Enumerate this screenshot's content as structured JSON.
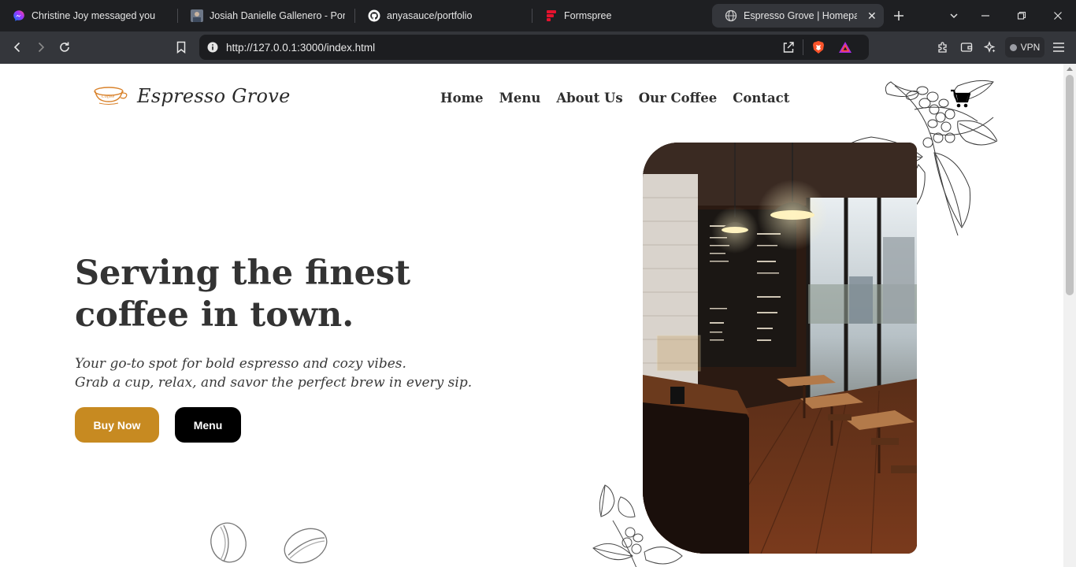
{
  "browser": {
    "tabs": [
      {
        "label": "Christine Joy messaged you",
        "icon": "messenger-icon"
      },
      {
        "label": "Josiah Danielle Gallenero - Portfo",
        "icon": "portfolio-favicon-icon"
      },
      {
        "label": "anyasauce/portfolio",
        "icon": "github-icon"
      },
      {
        "label": "Formspree",
        "icon": "formspree-icon"
      },
      {
        "label": "Espresso Grove | Homepage",
        "icon": "globe-icon"
      }
    ],
    "url": "http://127.0.0.1:3000/index.html",
    "vpn_label": "VPN"
  },
  "site": {
    "logo_text": "Espresso Grove",
    "logo_cup_text": "Coffee",
    "nav": [
      "Home",
      "Menu",
      "About Us",
      "Our Coffee",
      "Contact"
    ],
    "hero": {
      "title_line1": "Serving the finest",
      "title_line2": "coffee in town.",
      "subtitle_line1": "Your go-to spot for bold espresso and cozy vibes.",
      "subtitle_line2": "Grab a cup, relax, and savor the perfect brew in every sip.",
      "buy_button": "Buy Now",
      "menu_button": "Menu"
    },
    "colors": {
      "accent": "#c78a21",
      "text_dark": "#333333",
      "button_dark": "#000000"
    }
  }
}
